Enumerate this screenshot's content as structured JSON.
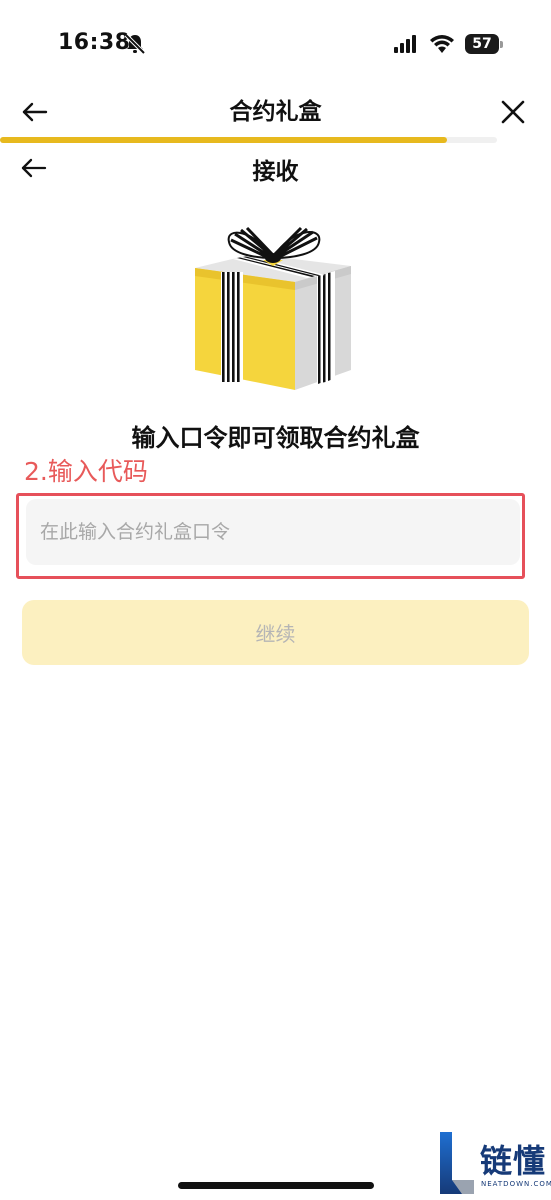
{
  "status_bar": {
    "time": "16:38",
    "battery": "57",
    "icons": [
      "bell-off-icon",
      "signal-icon",
      "wifi-icon",
      "battery-icon"
    ]
  },
  "nav": {
    "title": "合约礼盒",
    "back_icon": "arrow-left-icon",
    "close_icon": "close-icon",
    "progress": 0.9,
    "accent_color": "#e7b91e"
  },
  "sub_header": {
    "title": "接收",
    "back_icon": "arrow-left-icon"
  },
  "main": {
    "headline": "输入口令即可领取合约礼盒",
    "annotation": "2.输入代码",
    "annotation_color": "#e85a5a",
    "input": {
      "value": "",
      "placeholder": "在此输入合约礼盒口令"
    },
    "continue_label": "继续",
    "continue_color": "#fcf0c0"
  },
  "watermark": {
    "brand": "链懂",
    "sub": "NEATDOWN.COM"
  }
}
